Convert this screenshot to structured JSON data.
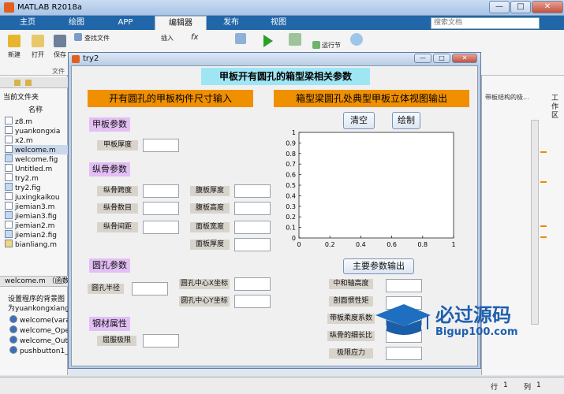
{
  "app": {
    "title": "MATLAB R2018a"
  },
  "window_buttons": {
    "minimize": "—",
    "maximize": "□",
    "close": "✕"
  },
  "ribbon": {
    "tabs": [
      "主页",
      "绘图",
      "APP",
      "编辑器",
      "发布",
      "视图"
    ],
    "search_placeholder": "搜索文档",
    "buttons": {
      "new": "新建",
      "open": "打开",
      "save": "保存",
      "find_files": "查找文件",
      "insert": "插入",
      "run_section": "运行节"
    },
    "file_group": "文件"
  },
  "file_browser": {
    "header": "当前文件夹",
    "column": "名称",
    "files": [
      "z8.m",
      "yuankongxia",
      "x2.m",
      "welcome.m",
      "welcome.fig",
      "Untitled.m",
      "try2.m",
      "try2.fig",
      "juxingkaikou",
      "jiemian3.m",
      "jiemian3.fig",
      "jiemian2.m",
      "jiemian2.fig",
      "bianliang.m"
    ],
    "selected": "welcome.m"
  },
  "details": {
    "title": "welcome.m （函数）",
    "desc1": "设置程序的背景图",
    "desc2": "为yuankongxiang",
    "functions": [
      "welcome(vara",
      "welcome_Ope",
      "welcome_Outp",
      "pushbutton1_"
    ]
  },
  "right_panel": {
    "label": "工作区",
    "doc_hint": "带板结构的极..."
  },
  "status": {
    "row_label": "行",
    "row": "1",
    "col_label": "列",
    "col": "1"
  },
  "figure": {
    "title": "try2",
    "main_title": "甲板开有圆孔的箱型梁相关参数",
    "left_banner": "开有圆孔的甲板构件尺寸输入",
    "right_banner": "箱型梁圆孔处典型甲板立体视图输出",
    "sections": {
      "deck": "甲板参数",
      "stiffener": "纵骨参数",
      "hole": "圆孔参数",
      "steel": "钢材属性"
    },
    "labels": {
      "deck_thickness": "甲板厚度",
      "stiff_span": "纵骨跨度",
      "stiff_count": "纵骨数目",
      "stiff_spacing": "纵骨间距",
      "web_thickness": "腹板厚度",
      "web_height": "腹板高度",
      "flange_width": "面板宽度",
      "flange_thickness": "面板厚度",
      "hole_radius": "圆孔半径",
      "hole_cx": "圆孔中心X坐标",
      "hole_cy": "圆孔中心Y坐标",
      "yield_limit": "屈服极限"
    },
    "buttons": {
      "clear": "清空",
      "plot": "绘制",
      "output": "主要参数输出"
    },
    "outputs": {
      "neutral_axis": "中和轴高度",
      "section_inertia": "剖面惯性矩",
      "flexibility": "带板柔度系数",
      "slenderness": "纵骨的细长比",
      "limit_stress": "极限应力"
    }
  },
  "chart_data": {
    "type": "line",
    "series": [],
    "xlim": [
      0,
      1
    ],
    "ylim": [
      0,
      1
    ],
    "x_ticks": [
      "0",
      "0.2",
      "0.4",
      "0.6",
      "0.8",
      "1"
    ],
    "y_ticks": [
      "0",
      "0.1",
      "0.2",
      "0.3",
      "0.4",
      "0.5",
      "0.6",
      "0.7",
      "0.8",
      "0.9",
      "1"
    ],
    "grid": false
  },
  "watermark": {
    "text1": "必过源码",
    "text2": "Bigup100.com"
  }
}
